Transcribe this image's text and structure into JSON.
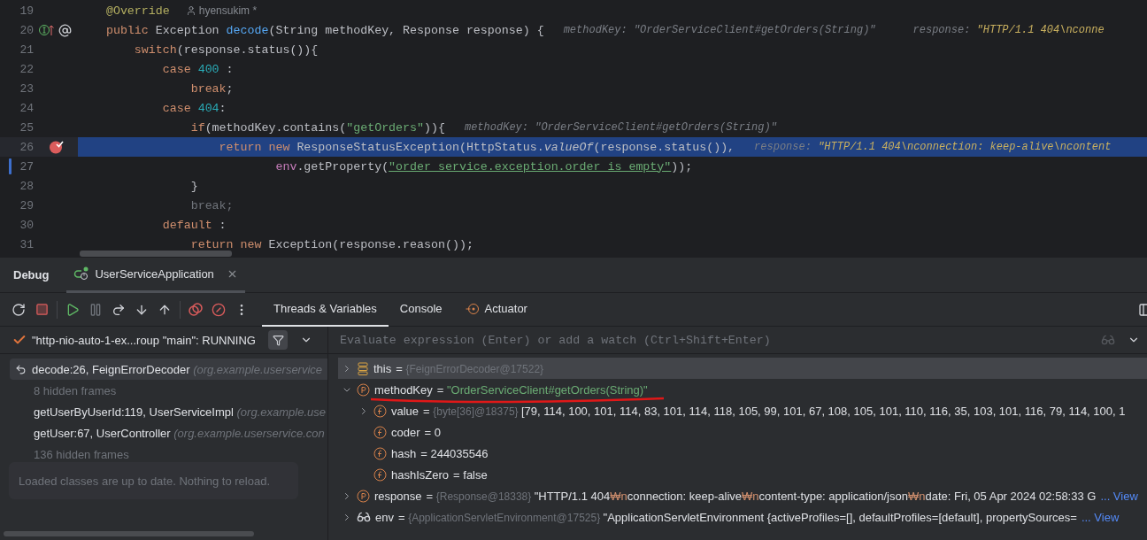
{
  "editor": {
    "lines": [
      {
        "number": "19",
        "current": false,
        "kind": "plain",
        "tokens": [
          {
            "text": "    @Override",
            "kind": "annotation"
          }
        ],
        "author": "hyensukim *"
      },
      {
        "number": "20",
        "current": false,
        "kind": "override",
        "tokens": [
          {
            "text": "    public ",
            "kind": "keyword"
          },
          {
            "text": "Exception ",
            "kind": "plain"
          },
          {
            "text": "decode",
            "kind": "method"
          },
          {
            "text": "(String methodKey, Response response) {",
            "kind": "plain"
          }
        ],
        "hints": [
          {
            "label": "methodKey:",
            "value": "\"OrderServiceClient#getOrders(String)\"",
            "kind": "muted"
          },
          {
            "label": "response:",
            "value": "\"HTTP/1.1 404\\nconne",
            "kind": "value"
          }
        ]
      },
      {
        "number": "21",
        "current": false,
        "kind": "plain",
        "tokens": [
          {
            "text": "        switch",
            "kind": "keyword"
          },
          {
            "text": "(response.status()){",
            "kind": "plain"
          }
        ]
      },
      {
        "number": "22",
        "current": false,
        "kind": "plain",
        "tokens": [
          {
            "text": "            case ",
            "kind": "keyword"
          },
          {
            "text": "400",
            "kind": "number"
          },
          {
            "text": " :",
            "kind": "plain"
          }
        ]
      },
      {
        "number": "23",
        "current": false,
        "kind": "plain",
        "tokens": [
          {
            "text": "                break",
            "kind": "keyword"
          },
          {
            "text": ";",
            "kind": "plain"
          }
        ]
      },
      {
        "number": "24",
        "current": false,
        "kind": "plain",
        "tokens": [
          {
            "text": "            case ",
            "kind": "keyword"
          },
          {
            "text": "404",
            "kind": "number"
          },
          {
            "text": ":",
            "kind": "plain"
          }
        ]
      },
      {
        "number": "25",
        "current": false,
        "kind": "plain",
        "tokens": [
          {
            "text": "                if",
            "kind": "keyword"
          },
          {
            "text": "(methodKey.contains(",
            "kind": "plain"
          },
          {
            "text": "\"getOrders\"",
            "kind": "string"
          },
          {
            "text": ")){",
            "kind": "plain"
          }
        ],
        "hints": [
          {
            "label": "methodKey:",
            "value": "\"OrderServiceClient#getOrders(String)\"",
            "kind": "muted"
          }
        ]
      },
      {
        "number": "26",
        "current": true,
        "kind": "breakpoint",
        "tokens": [
          {
            "text": "                    return new ",
            "kind": "keyword"
          },
          {
            "text": "ResponseStatusException(HttpStatus.",
            "kind": "plain"
          },
          {
            "text": "valueOf",
            "kind": "italic"
          },
          {
            "text": "(response.status()),",
            "kind": "plain"
          }
        ],
        "hints": [
          {
            "label": "response:",
            "value": "\"HTTP/1.1 404\\nconnection: keep-alive\\ncontent",
            "kind": "value"
          }
        ]
      },
      {
        "number": "27",
        "current": false,
        "kind": "changed",
        "tokens": [
          {
            "text": "                            env",
            "kind": "field"
          },
          {
            "text": ".getProperty(",
            "kind": "plain"
          },
          {
            "text": "\"order_service.exception.order_is_empty\"",
            "kind": "link"
          },
          {
            "text": "));",
            "kind": "plain"
          }
        ]
      },
      {
        "number": "28",
        "current": false,
        "kind": "plain",
        "tokens": [
          {
            "text": "                }",
            "kind": "plain"
          }
        ]
      },
      {
        "number": "29",
        "current": false,
        "kind": "plain",
        "tokens": [
          {
            "text": "                break;",
            "kind": "dim"
          }
        ]
      },
      {
        "number": "30",
        "current": false,
        "kind": "plain",
        "tokens": [
          {
            "text": "            default",
            "kind": "keyword"
          },
          {
            "text": " :",
            "kind": "plain"
          }
        ]
      },
      {
        "number": "31",
        "current": false,
        "kind": "plain",
        "tokens": [
          {
            "text": "                return new ",
            "kind": "keyword"
          },
          {
            "text": "Exception(response.reason());",
            "kind": "plain"
          }
        ]
      }
    ]
  },
  "debug": {
    "title": "Debug",
    "run_tab": "UserServiceApplication",
    "tabs": [
      {
        "label": "Threads & Variables",
        "selected": true,
        "kind": "plain"
      },
      {
        "label": "Console",
        "selected": false,
        "kind": "plain"
      },
      {
        "label": "Actuator",
        "selected": false,
        "kind": "actuator"
      }
    ],
    "thread": "\"http-nio-auto-1-ex...roup \"main\": RUNNING",
    "frames": [
      {
        "kind": "frame",
        "method": "decode:26, FeignErrorDecoder",
        "location": "(org.example.userservice",
        "selected": true
      },
      {
        "kind": "hidden",
        "method": "8 hidden frames",
        "selected": false
      },
      {
        "kind": "frame",
        "method": "getUserByUserId:119, UserServiceImpl",
        "location": "(org.example.use",
        "selected": false
      },
      {
        "kind": "frame",
        "method": "getUser:67, UserController",
        "location": "(org.example.userservice.con",
        "selected": false
      },
      {
        "kind": "hidden",
        "method": "136 hidden frames",
        "selected": false
      }
    ],
    "tooltip": "Loaded classes are up to date. Nothing to reload.",
    "evaluate": {
      "placeholder": "Evaluate expression (Enter) or add a watch (Ctrl+Shift+Enter)"
    },
    "variables": [
      {
        "kind": "object",
        "name": "this",
        "assign": "=",
        "type_info": "{FeignErrorDecoder@17522}",
        "expanded": false,
        "selected": true
      },
      {
        "kind": "param",
        "name": "methodKey",
        "assign": "=",
        "expanded": true,
        "selected": false,
        "segments": [
          {
            "text": "\"OrderServiceClient#getOrders(String)\"",
            "kind": "string"
          }
        ],
        "children": [
          {
            "kind": "field",
            "name": "value",
            "assign": "=",
            "type_info": "{byte[36]@18375}",
            "expanded": false,
            "selected": false,
            "segments": [
              {
                "text": "[79, 114, 100, 101, 114, 83, 101, 114, 118, 105, 99, 101, 67, 108, 105, 101, 110, 116, 35, 103, 101, 116, 79, 114, 100, 1",
                "kind": "plain"
              }
            ]
          },
          {
            "kind": "field",
            "name": "coder",
            "assign": "=",
            "selected": false,
            "segments": [
              {
                "text": "0",
                "kind": "plain"
              }
            ]
          },
          {
            "kind": "field",
            "name": "hash",
            "assign": "=",
            "selected": false,
            "segments": [
              {
                "text": "244035546",
                "kind": "plain"
              }
            ]
          },
          {
            "kind": "field",
            "name": "hashIsZero",
            "assign": "=",
            "selected": false,
            "segments": [
              {
                "text": "false",
                "kind": "plain"
              }
            ]
          }
        ]
      },
      {
        "kind": "param",
        "name": "response",
        "assign": "=",
        "type_info": "{Response@18338}",
        "expanded": false,
        "selected": false,
        "segments": [
          {
            "text": "\"HTTP/1.1 404",
            "kind": "plain"
          },
          {
            "text": "₩n",
            "kind": "escape"
          },
          {
            "text": "connection: keep-alive",
            "kind": "plain"
          },
          {
            "text": "₩n",
            "kind": "escape"
          },
          {
            "text": "content-type: application/json",
            "kind": "plain"
          },
          {
            "text": "₩n",
            "kind": "escape"
          },
          {
            "text": "date: Fri, 05 Apr 2024 02:58:33 G",
            "kind": "plain"
          }
        ],
        "link": "... View"
      },
      {
        "kind": "watch",
        "name": "env",
        "assign": "=",
        "type_info": "{ApplicationServletEnvironment@17525}",
        "expanded": false,
        "selected": false,
        "segments": [
          {
            "text": "\"ApplicationServletEnvironment {activeProfiles=[], defaultProfiles=[default], propertySources=",
            "kind": "plain"
          }
        ],
        "link": "... View"
      }
    ]
  }
}
